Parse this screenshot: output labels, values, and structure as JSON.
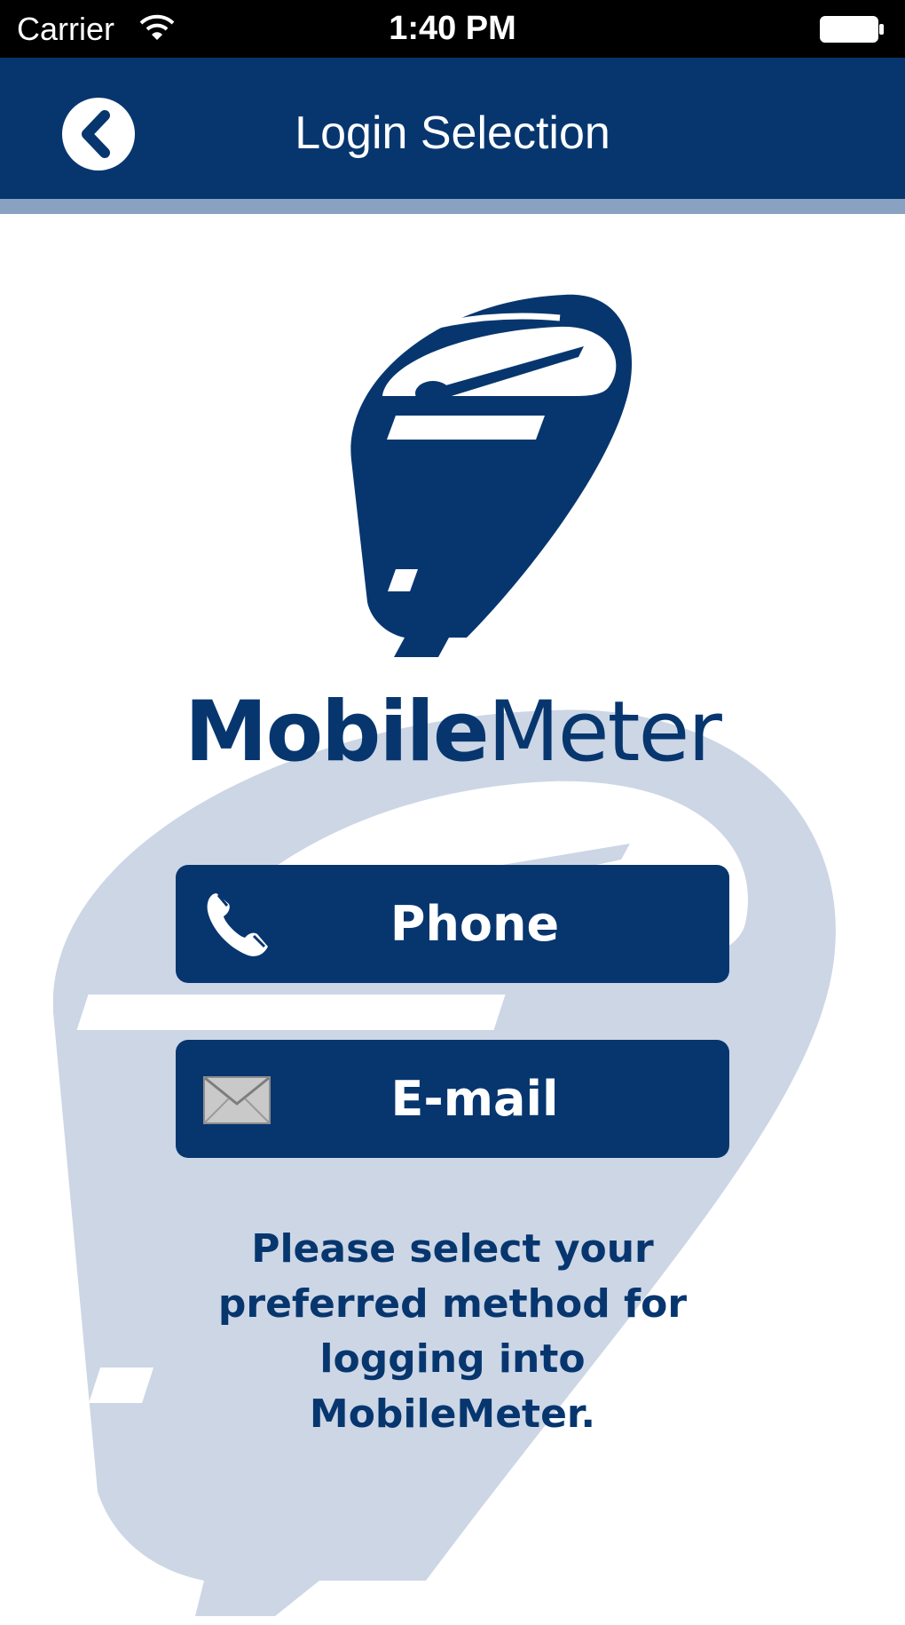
{
  "status_bar": {
    "carrier": "Carrier",
    "time": "1:40 PM",
    "wifi_icon": "wifi-icon",
    "battery_icon": "battery-icon"
  },
  "nav": {
    "title": "Login Selection",
    "back_icon": "chevron-left-icon"
  },
  "logo": {
    "icon": "parking-meter-icon",
    "wordmark_bold": "Mobile",
    "wordmark_light": "Meter"
  },
  "buttons": {
    "phone": {
      "label": "Phone",
      "icon": "phone-icon"
    },
    "email": {
      "label": "E-mail",
      "icon": "envelope-icon"
    }
  },
  "instructions": "Please select your preferred method for logging into MobileMeter.",
  "colors": {
    "brand_navy": "#07366f",
    "nav_stripe": "#8aa2c2",
    "watermark": "#ccd6e5",
    "background": "#ffffff"
  }
}
